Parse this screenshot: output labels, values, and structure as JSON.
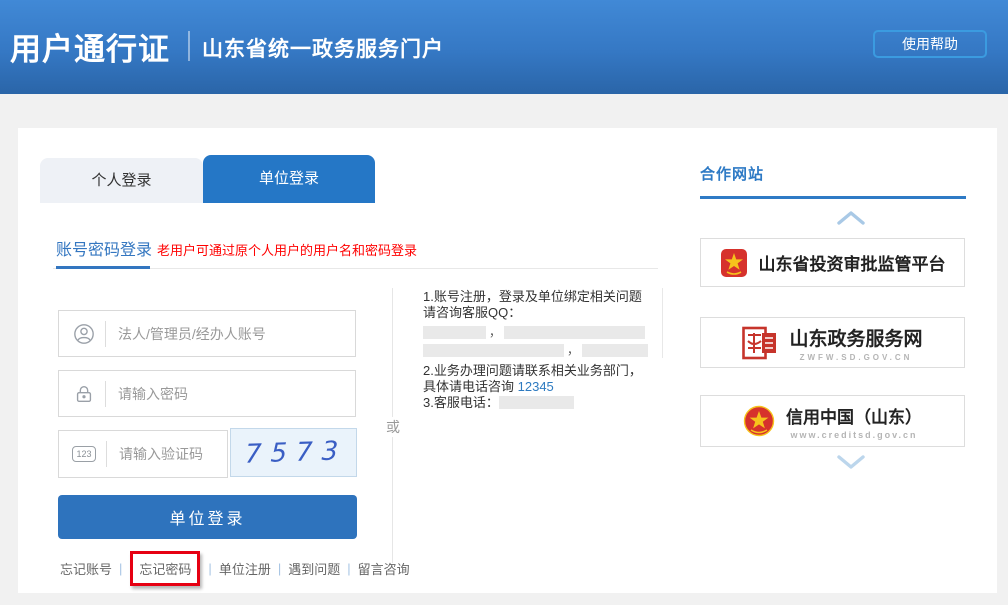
{
  "header": {
    "brand": "用户通行证",
    "portal": "山东省统一政务服务门户",
    "help_button": "使用帮助"
  },
  "tabs": {
    "personal": "个人登录",
    "unit": "单位登录"
  },
  "login": {
    "section_title": "账号密码登录",
    "section_note": "老用户可通过原个人用户的用户名和密码登录",
    "account_placeholder": "法人/管理员/经办人账号",
    "password_placeholder": "请输入密码",
    "captcha_placeholder": "请输入验证码",
    "captcha_code": "7573",
    "or_label": "或",
    "submit_label": "单位登录",
    "link_separator": "|",
    "links": {
      "forgot_account": "忘记账号",
      "forgot_password": "忘记密码",
      "register": "单位注册",
      "problems": "遇到问题",
      "feedback": "留言咨询"
    }
  },
  "help": {
    "item1_line1": "1.账号注册，登录及单位绑定相关问题",
    "item1_line2": "请咨询客服QQ：",
    "qq_separator": "，",
    "item2_line1": "2.业务办理问题请联系相关业务部门，",
    "item2_line2_prefix": "具体请电话咨询 ",
    "item2_phone": "12345",
    "item3_prefix": "3.客服电话："
  },
  "sidebar": {
    "title": "合作网站",
    "sites": [
      {
        "name": "山东省投资审批监管平台",
        "subtitle": ""
      },
      {
        "name": "山东政务服务网",
        "subtitle": "ZWFW.SD.GOV.CN"
      },
      {
        "name": "信用中国（山东）",
        "subtitle": "www.creditsd.gov.cn"
      }
    ]
  },
  "colors": {
    "accent_blue": "#2577c6",
    "note_red": "#ff0000",
    "annotation_red": "#e60012",
    "captcha_ink": "#3a5ec4"
  }
}
